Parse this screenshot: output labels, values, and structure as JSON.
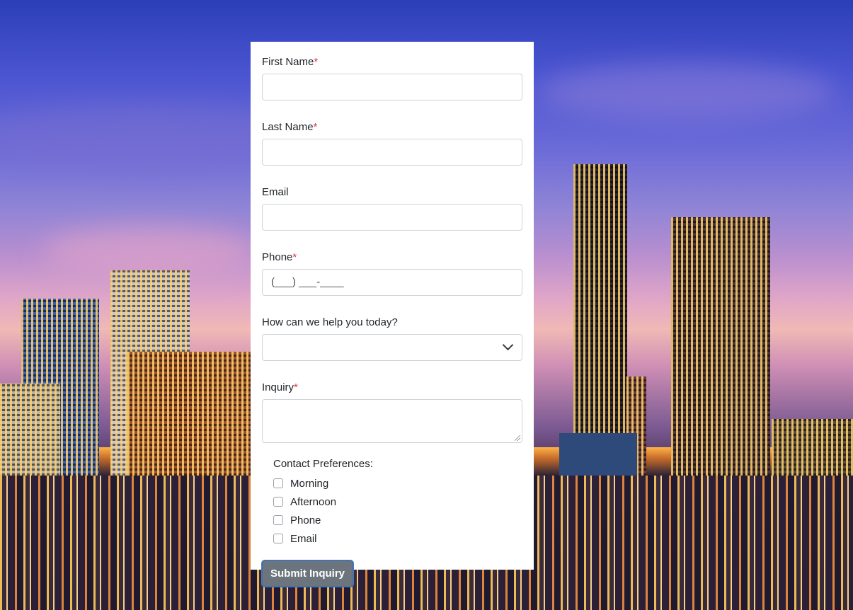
{
  "form": {
    "first_name": {
      "label": "First Name",
      "required_mark": "*",
      "value": ""
    },
    "last_name": {
      "label": "Last Name",
      "required_mark": "*",
      "value": ""
    },
    "email": {
      "label": "Email",
      "value": ""
    },
    "phone": {
      "label": "Phone",
      "required_mark": "*",
      "placeholder": "(___) ___-____"
    },
    "help_select": {
      "label": "How can we help you today?",
      "selected": ""
    },
    "inquiry": {
      "label": "Inquiry",
      "required_mark": "*",
      "value": ""
    },
    "contact_preferences": {
      "title": "Contact Preferences:",
      "options": [
        {
          "label": "Morning",
          "checked": false
        },
        {
          "label": "Afternoon",
          "checked": false
        },
        {
          "label": "Phone",
          "checked": false
        },
        {
          "label": "Email",
          "checked": false
        }
      ]
    },
    "submit_label": "Submit Inquiry"
  },
  "colors": {
    "required": "#dc3545",
    "button_bg": "#6c757d",
    "card_bg": "#ffffff"
  },
  "icons": {
    "select_arrow": "chevron-down-icon",
    "textarea_resize": "resize-grip-icon"
  }
}
